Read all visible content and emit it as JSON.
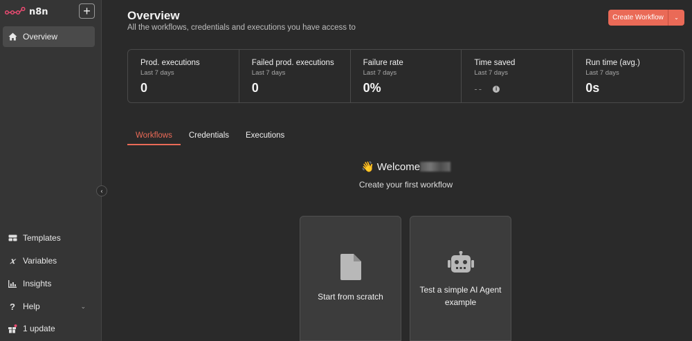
{
  "app": {
    "name": "n8n",
    "accent": "#ea6a57"
  },
  "sidebar": {
    "add_label": "+",
    "nav": [
      {
        "label": "Overview",
        "icon": "home-icon",
        "active": true
      }
    ],
    "bottom": [
      {
        "label": "Templates",
        "icon": "templates-icon"
      },
      {
        "label": "Variables",
        "icon": "variables-icon"
      },
      {
        "label": "Insights",
        "icon": "insights-icon"
      },
      {
        "label": "Help",
        "icon": "help-icon"
      },
      {
        "label": "1 update",
        "icon": "gift-icon"
      }
    ]
  },
  "header": {
    "title": "Overview",
    "subtitle": "All the workflows, credentials and executions you have access to",
    "create_button": "Create Workflow"
  },
  "stats": [
    {
      "title": "Prod. executions",
      "period": "Last 7 days",
      "value": "0"
    },
    {
      "title": "Failed prod. executions",
      "period": "Last 7 days",
      "value": "0"
    },
    {
      "title": "Failure rate",
      "period": "Last 7 days",
      "value": "0%"
    },
    {
      "title": "Time saved",
      "period": "Last 7 days",
      "value": "--"
    },
    {
      "title": "Run time (avg.)",
      "period": "Last 7 days",
      "value": "0s"
    }
  ],
  "tabs": [
    {
      "label": "Workflows",
      "active": true
    },
    {
      "label": "Credentials"
    },
    {
      "label": "Executions"
    }
  ],
  "welcome": {
    "emoji": "👋",
    "greeting": "Welcome",
    "subtitle": "Create your first workflow"
  },
  "cards": [
    {
      "label": "Start from scratch",
      "icon": "file-icon"
    },
    {
      "label": "Test a simple AI Agent example",
      "icon": "robot-icon"
    }
  ]
}
